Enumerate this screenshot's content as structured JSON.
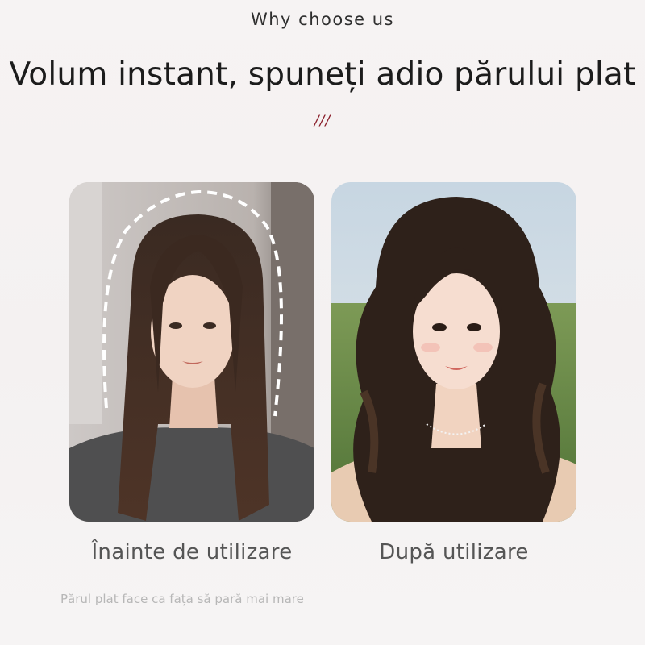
{
  "header": {
    "eyebrow": "Why choose us",
    "headline": "Volum instant, spuneți adio părului plat",
    "decor": "///"
  },
  "photos": {
    "before": {
      "caption": "Înainte de utilizare",
      "icon": "portrait-flat-hair"
    },
    "after": {
      "caption": "După utilizare",
      "icon": "portrait-voluminous-hair"
    }
  },
  "note": "Părul plat face ca fața să pară mai mare",
  "colors": {
    "accent": "#8a1f2b",
    "background": "#f5f2f2"
  }
}
